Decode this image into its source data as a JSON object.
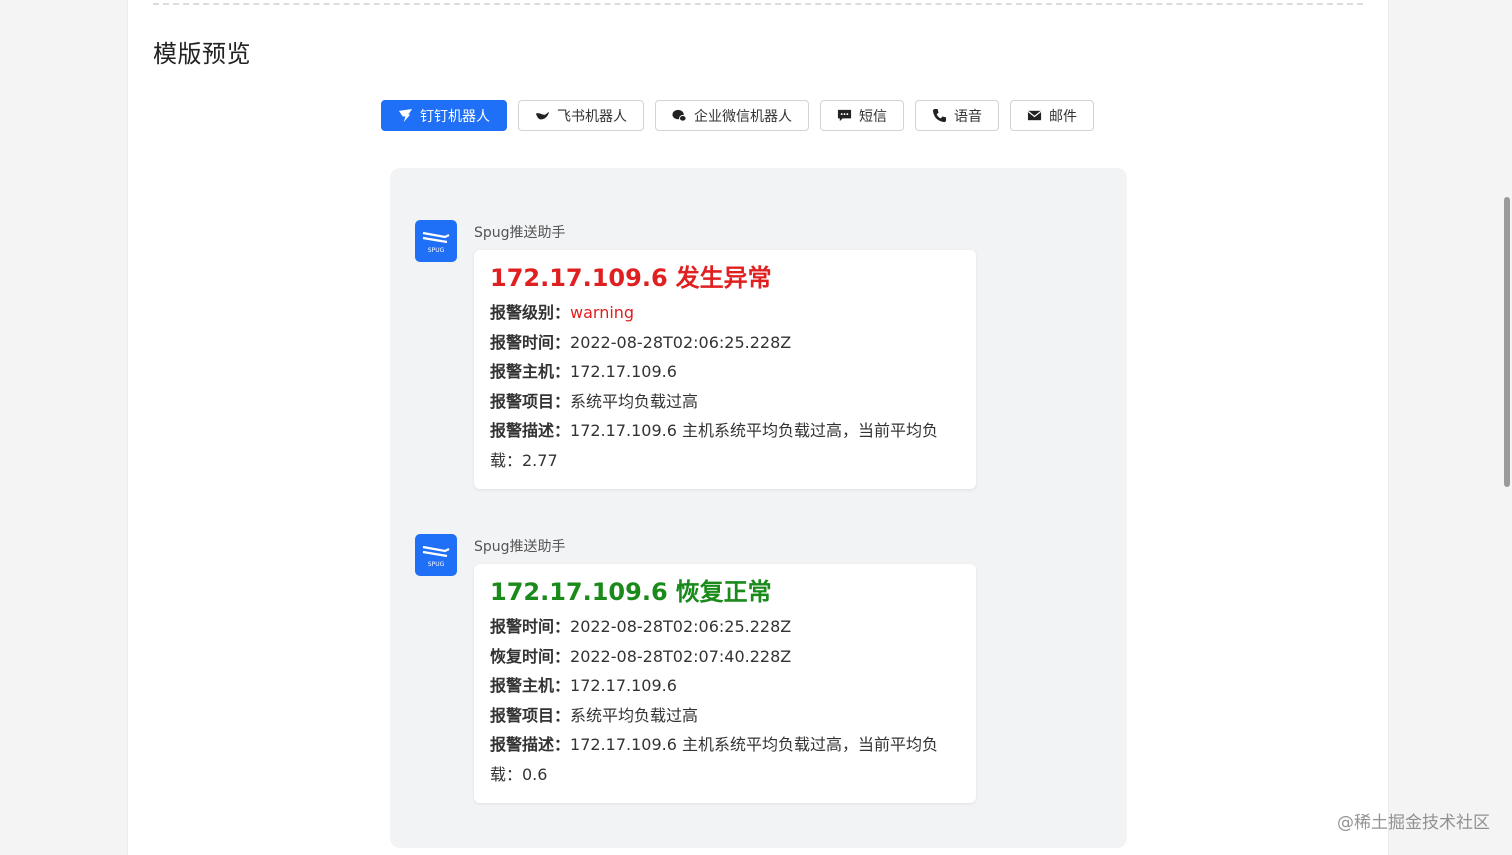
{
  "section_title": "模版预览",
  "tabs": [
    {
      "label": "钉钉机器人",
      "icon": "dingtalk-icon",
      "active": true
    },
    {
      "label": "飞书机器人",
      "icon": "feishu-icon",
      "active": false
    },
    {
      "label": "企业微信机器人",
      "icon": "wecom-icon",
      "active": false
    },
    {
      "label": "短信",
      "icon": "sms-icon",
      "active": false
    },
    {
      "label": "语音",
      "icon": "phone-icon",
      "active": false
    },
    {
      "label": "邮件",
      "icon": "mail-icon",
      "active": false
    }
  ],
  "messages": [
    {
      "sender": "Spug推送助手",
      "avatar_text": "SPUG",
      "title_ip": "172.17.109.6",
      "title_status": "发生异常",
      "lines": [
        {
          "key": "报警级别：",
          "value": "warning"
        },
        {
          "key": "报警时间：",
          "value": "2022-08-28T02:06:25.228Z"
        },
        {
          "key": "报警主机：",
          "value": "172.17.109.6"
        },
        {
          "key": "报警项目：",
          "value": "系统平均负载过高"
        },
        {
          "key": "报警描述：",
          "value": "172.17.109.6 主机系统平均负载过高，当前平均负载：2.77"
        }
      ]
    },
    {
      "sender": "Spug推送助手",
      "avatar_text": "SPUG",
      "title_ip": "172.17.109.6",
      "title_status": "恢复正常",
      "lines": [
        {
          "key": "报警时间：",
          "value": "2022-08-28T02:06:25.228Z"
        },
        {
          "key": "恢复时间：",
          "value": "2022-08-28T02:07:40.228Z"
        },
        {
          "key": "报警主机：",
          "value": "172.17.109.6"
        },
        {
          "key": "报警项目：",
          "value": "系统平均负载过高"
        },
        {
          "key": "报警描述：",
          "value": "172.17.109.6 主机系统平均负载过高，当前平均负载：0.6"
        }
      ]
    }
  ],
  "watermark": "@稀土掘金技术社区",
  "colors": {
    "accent": "#1f6ff7",
    "alarm": "#e02020",
    "recover": "#1a8a1a"
  }
}
